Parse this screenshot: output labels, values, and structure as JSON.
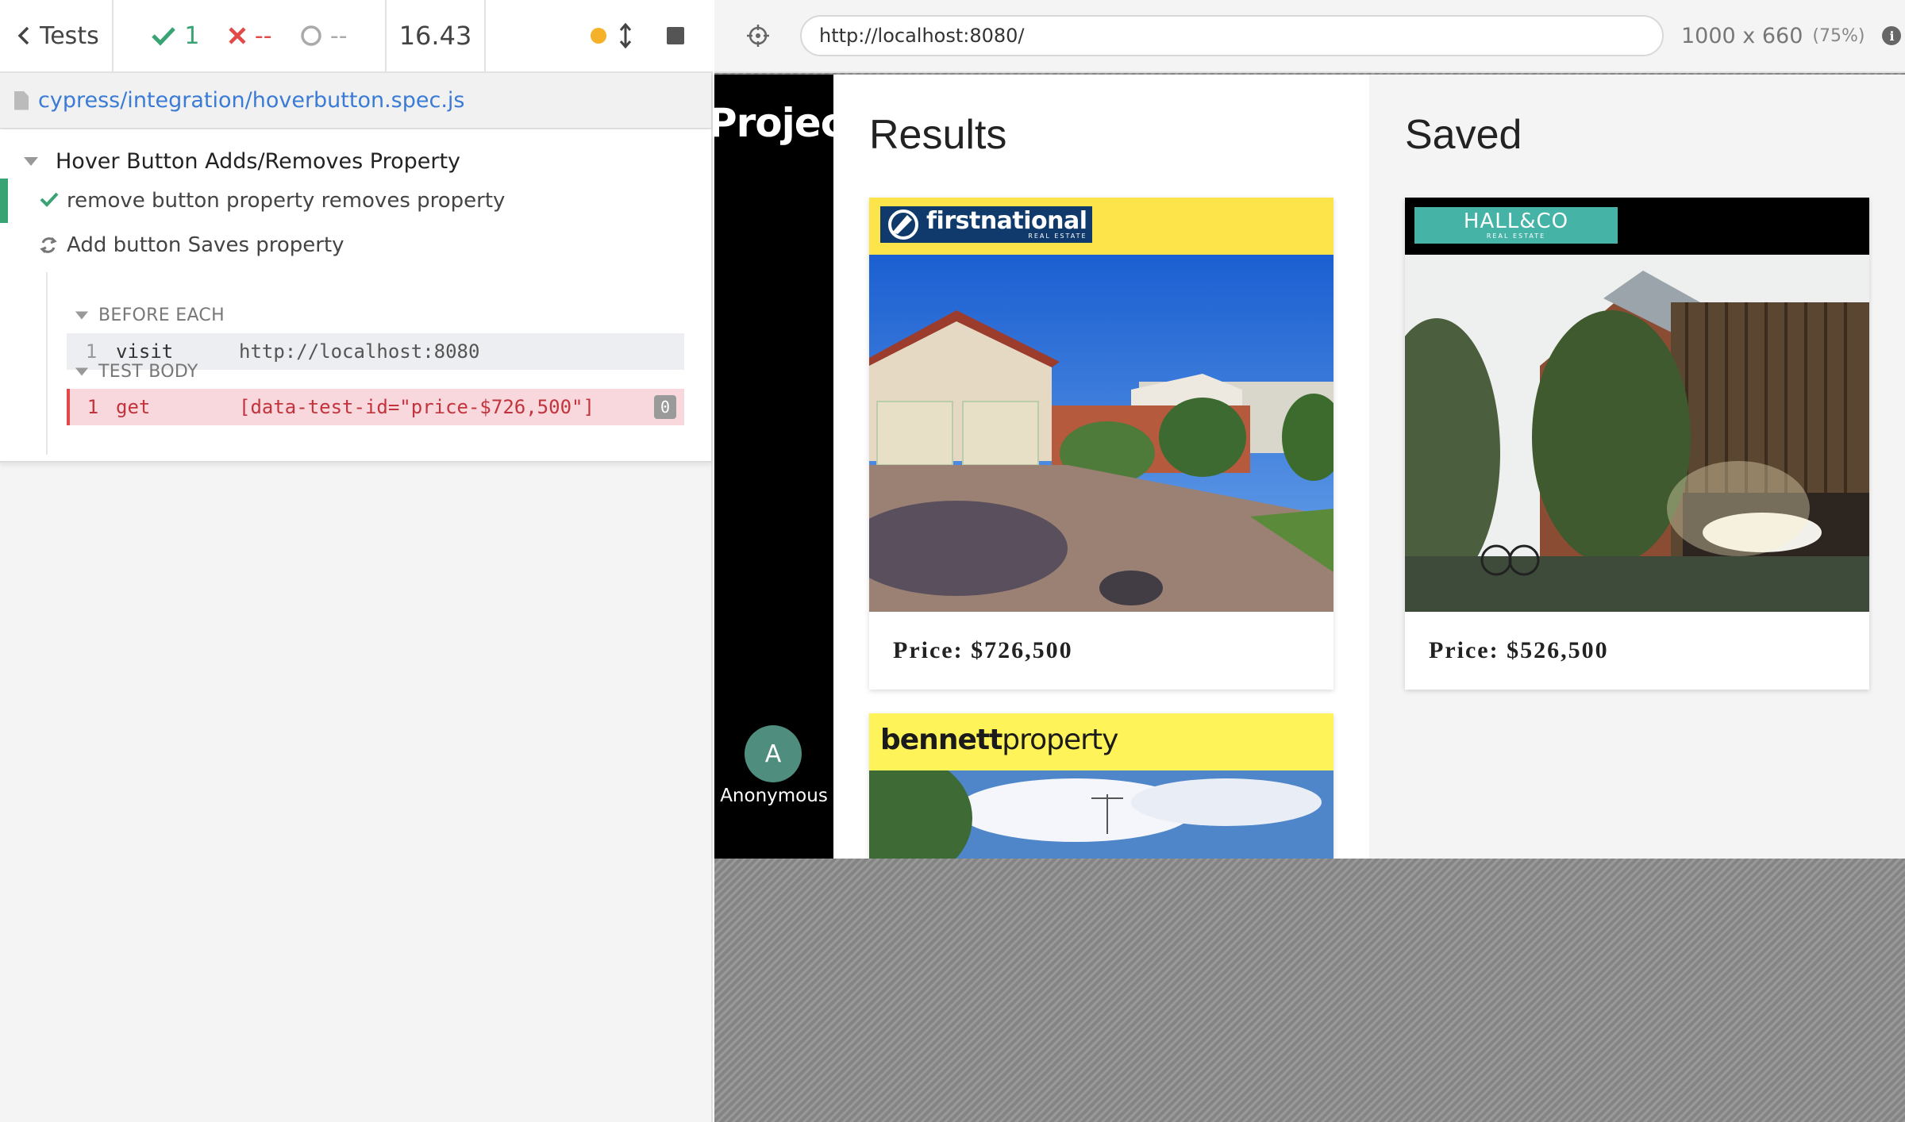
{
  "reporter": {
    "tests_label": "Tests",
    "passed_count": "1",
    "failed_count": "--",
    "pending_count": "--",
    "duration": "16.43",
    "spec_path": "cypress/integration/hoverbutton.spec.js",
    "suite_title": "Hover Button Adds/Removes Property",
    "tests": [
      {
        "title": "remove button property removes property",
        "state": "passed"
      },
      {
        "title": "Add button Saves property",
        "state": "running"
      }
    ],
    "hooks": [
      {
        "title": "BEFORE EACH",
        "commands": [
          {
            "number": "1",
            "name": "visit",
            "message": "http://localhost:8080"
          }
        ]
      },
      {
        "title": "TEST BODY",
        "commands": [
          {
            "number": "1",
            "name": "get",
            "message": "[data-test-id=\"price-$726,500\"]",
            "count": "0"
          }
        ]
      }
    ]
  },
  "preview": {
    "url": "http://localhost:8080/",
    "viewport": "1000 x 660",
    "scale": "(75%)"
  },
  "app": {
    "name": "Project",
    "user_initial": "A",
    "username": "Anonymous",
    "results": {
      "title": "Results",
      "cards": [
        {
          "agency": "firstnational",
          "agency_sub": "REAL ESTATE",
          "banner_color": "#fde44a",
          "price": "Price: $726,500"
        },
        {
          "agency_bold": "bennett",
          "agency_light": "property",
          "banner_color": "#fef45a"
        }
      ]
    },
    "saved": {
      "title": "Saved",
      "cards": [
        {
          "agency": "HALL&CO",
          "agency_sub": "REAL ESTATE",
          "banner_color": "#000000",
          "price": "Price: $526,500"
        }
      ]
    }
  },
  "colors": {
    "pass": "#3aa374",
    "fail": "#e24a4a",
    "link": "#3a7bd5",
    "running": "#f5b12a"
  }
}
